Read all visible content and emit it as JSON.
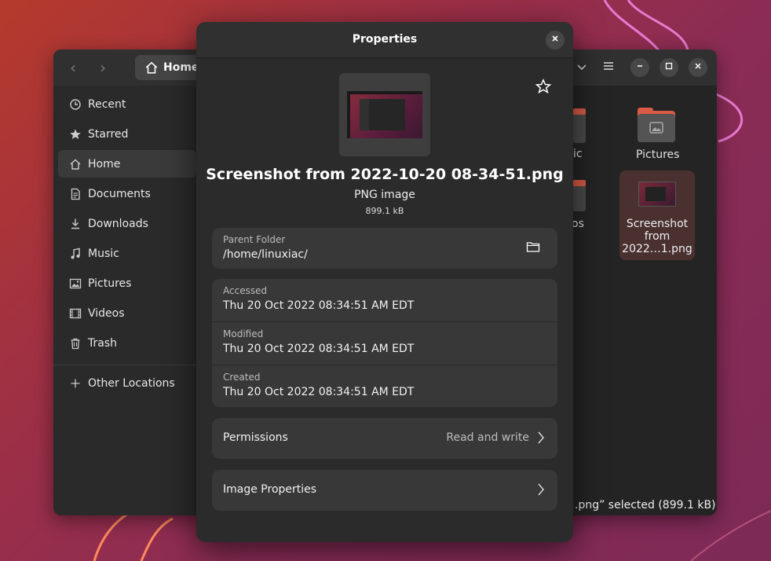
{
  "files_window": {
    "path_label": "Home",
    "sidebar": [
      {
        "label": "Recent",
        "icon": "clock-icon"
      },
      {
        "label": "Starred",
        "icon": "star-icon"
      },
      {
        "label": "Home",
        "icon": "home-icon",
        "active": true
      },
      {
        "label": "Documents",
        "icon": "document-icon"
      },
      {
        "label": "Downloads",
        "icon": "download-icon"
      },
      {
        "label": "Music",
        "icon": "music-icon"
      },
      {
        "label": "Pictures",
        "icon": "picture-icon"
      },
      {
        "label": "Videos",
        "icon": "video-icon"
      },
      {
        "label": "Trash",
        "icon": "trash-icon"
      },
      {
        "label": "Other Locations",
        "icon": "plus-icon"
      }
    ],
    "grid": {
      "partial_music": "ic",
      "pictures": "Pictures",
      "partial_videos": "os",
      "selected_file_line1": "Screenshot",
      "selected_file_line2": "from",
      "selected_file_line3": "2022…1.png"
    },
    "status": ".png” selected  (899.1 kB)"
  },
  "dialog": {
    "title": "Properties",
    "file_name": "Screenshot from 2022-10-20 08-34-51.png",
    "file_type": "PNG image",
    "file_size": "899.1 kB",
    "parent_folder": {
      "key": "Parent Folder",
      "value": "/home/linuxiac/"
    },
    "times": [
      {
        "key": "Accessed",
        "value": "Thu 20 Oct 2022 08:34:51 AM EDT"
      },
      {
        "key": "Modified",
        "value": "Thu 20 Oct 2022 08:34:51 AM EDT"
      },
      {
        "key": "Created",
        "value": "Thu 20 Oct 2022 08:34:51 AM EDT"
      }
    ],
    "permissions": {
      "label": "Permissions",
      "value": "Read and write"
    },
    "image_properties": {
      "label": "Image Properties"
    }
  },
  "colors": {
    "window_bg": "#242424",
    "dialog_bg": "#2b2b2b",
    "card_bg": "#383838",
    "folder_tab": "#d95b45",
    "selection": "#4a3130"
  }
}
